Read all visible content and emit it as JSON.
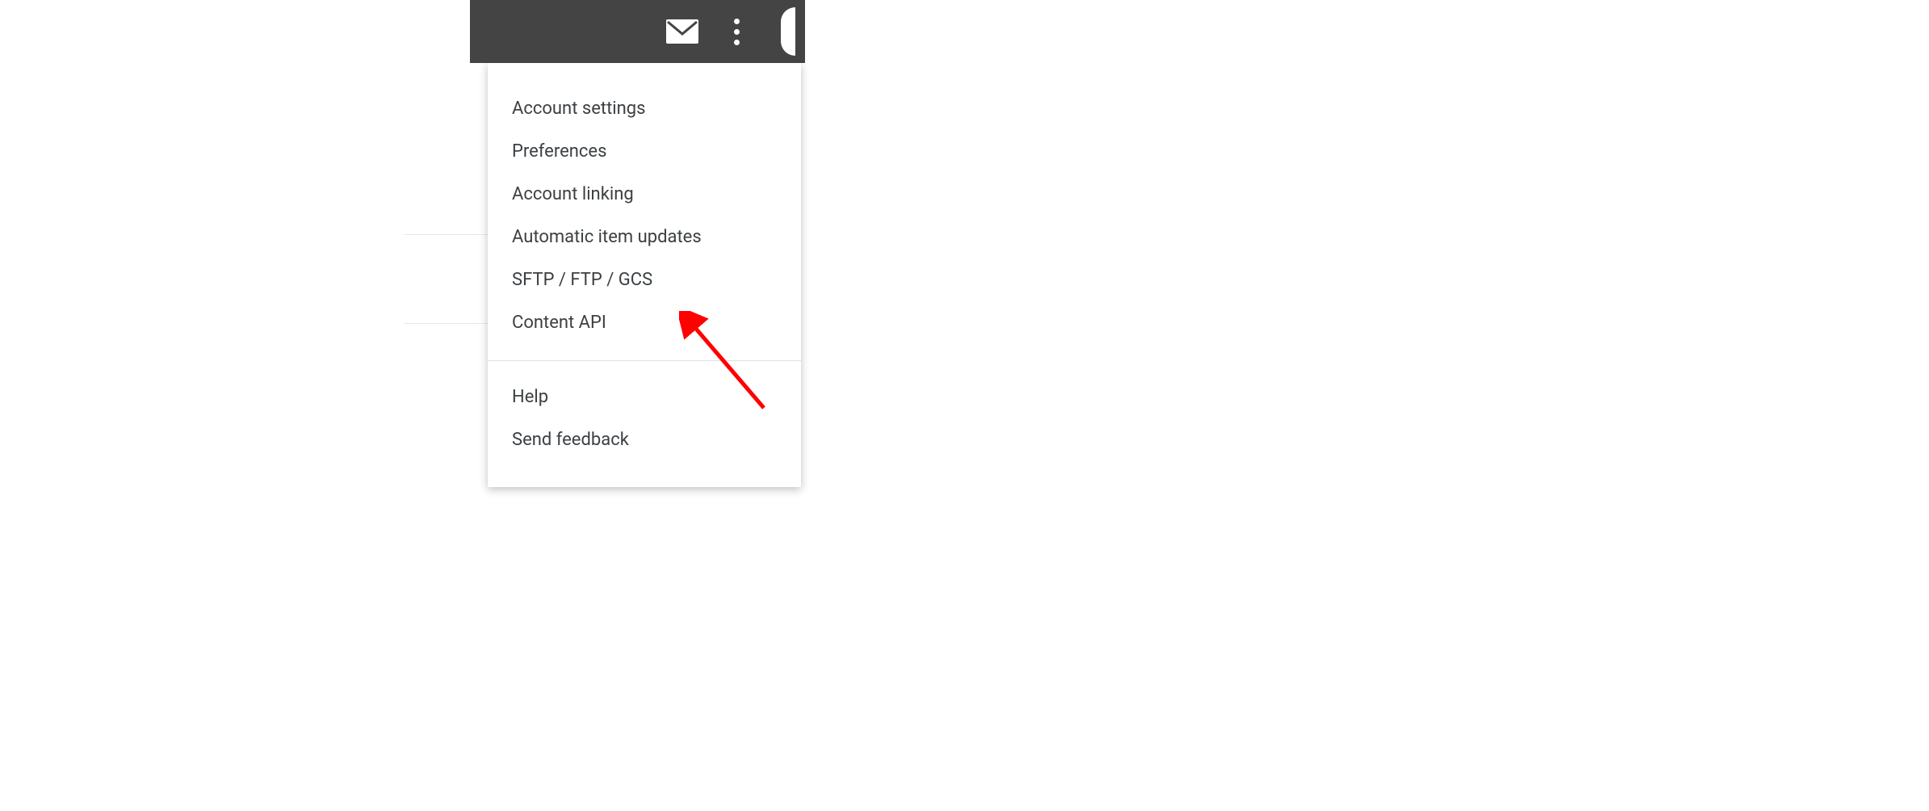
{
  "menu": {
    "section1": [
      {
        "label": "Account settings"
      },
      {
        "label": "Preferences"
      },
      {
        "label": "Account linking"
      },
      {
        "label": "Automatic item updates"
      },
      {
        "label": "SFTP / FTP / GCS"
      },
      {
        "label": "Content API"
      }
    ],
    "section2": [
      {
        "label": "Help"
      },
      {
        "label": "Send feedback"
      }
    ]
  },
  "colors": {
    "headerBg": "#444444",
    "arrow": "#ff0000",
    "text": "#3c4043"
  }
}
